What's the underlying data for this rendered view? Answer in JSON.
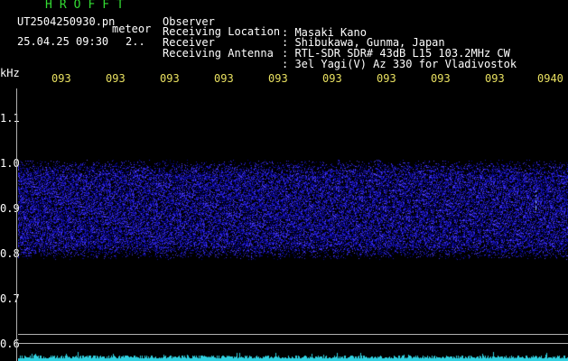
{
  "header": {
    "app_title": "HROFFT",
    "file_name": "UT2504250930.pn",
    "meteor_label": "meteor",
    "datetime": "25.04.25 09:30",
    "count": "2.."
  },
  "meta": [
    {
      "key": "Observer",
      "value": ": Masaki Kano"
    },
    {
      "key": "Receiving Location",
      "value": ": Shibukawa, Gunma, Japan"
    },
    {
      "key": "Receiver",
      "value": ": RTL-SDR SDR# 43dB L15 103.2MHz CW"
    },
    {
      "key": "Receiving Antenna",
      "value": ": 3el Yagi(V) Az 330 for Vladivostok"
    }
  ],
  "time_axis": {
    "labels": [
      "093",
      "093",
      "093",
      "093",
      "093",
      "093",
      "093",
      "093",
      "093",
      "0940"
    ]
  },
  "freq_axis": {
    "unit": "kHz",
    "labels": [
      "1.1",
      "1.0",
      "0.9",
      "0.8",
      "0.7",
      "0.6"
    ]
  },
  "colors": {
    "title_green": "#33dd33",
    "text_white": "#ffffff",
    "tick_yellow": "#e8e060",
    "axis_line": "#b0b0b0",
    "noise_blue": "#2030c0",
    "baseline_cyan": "#30d0e0"
  }
}
